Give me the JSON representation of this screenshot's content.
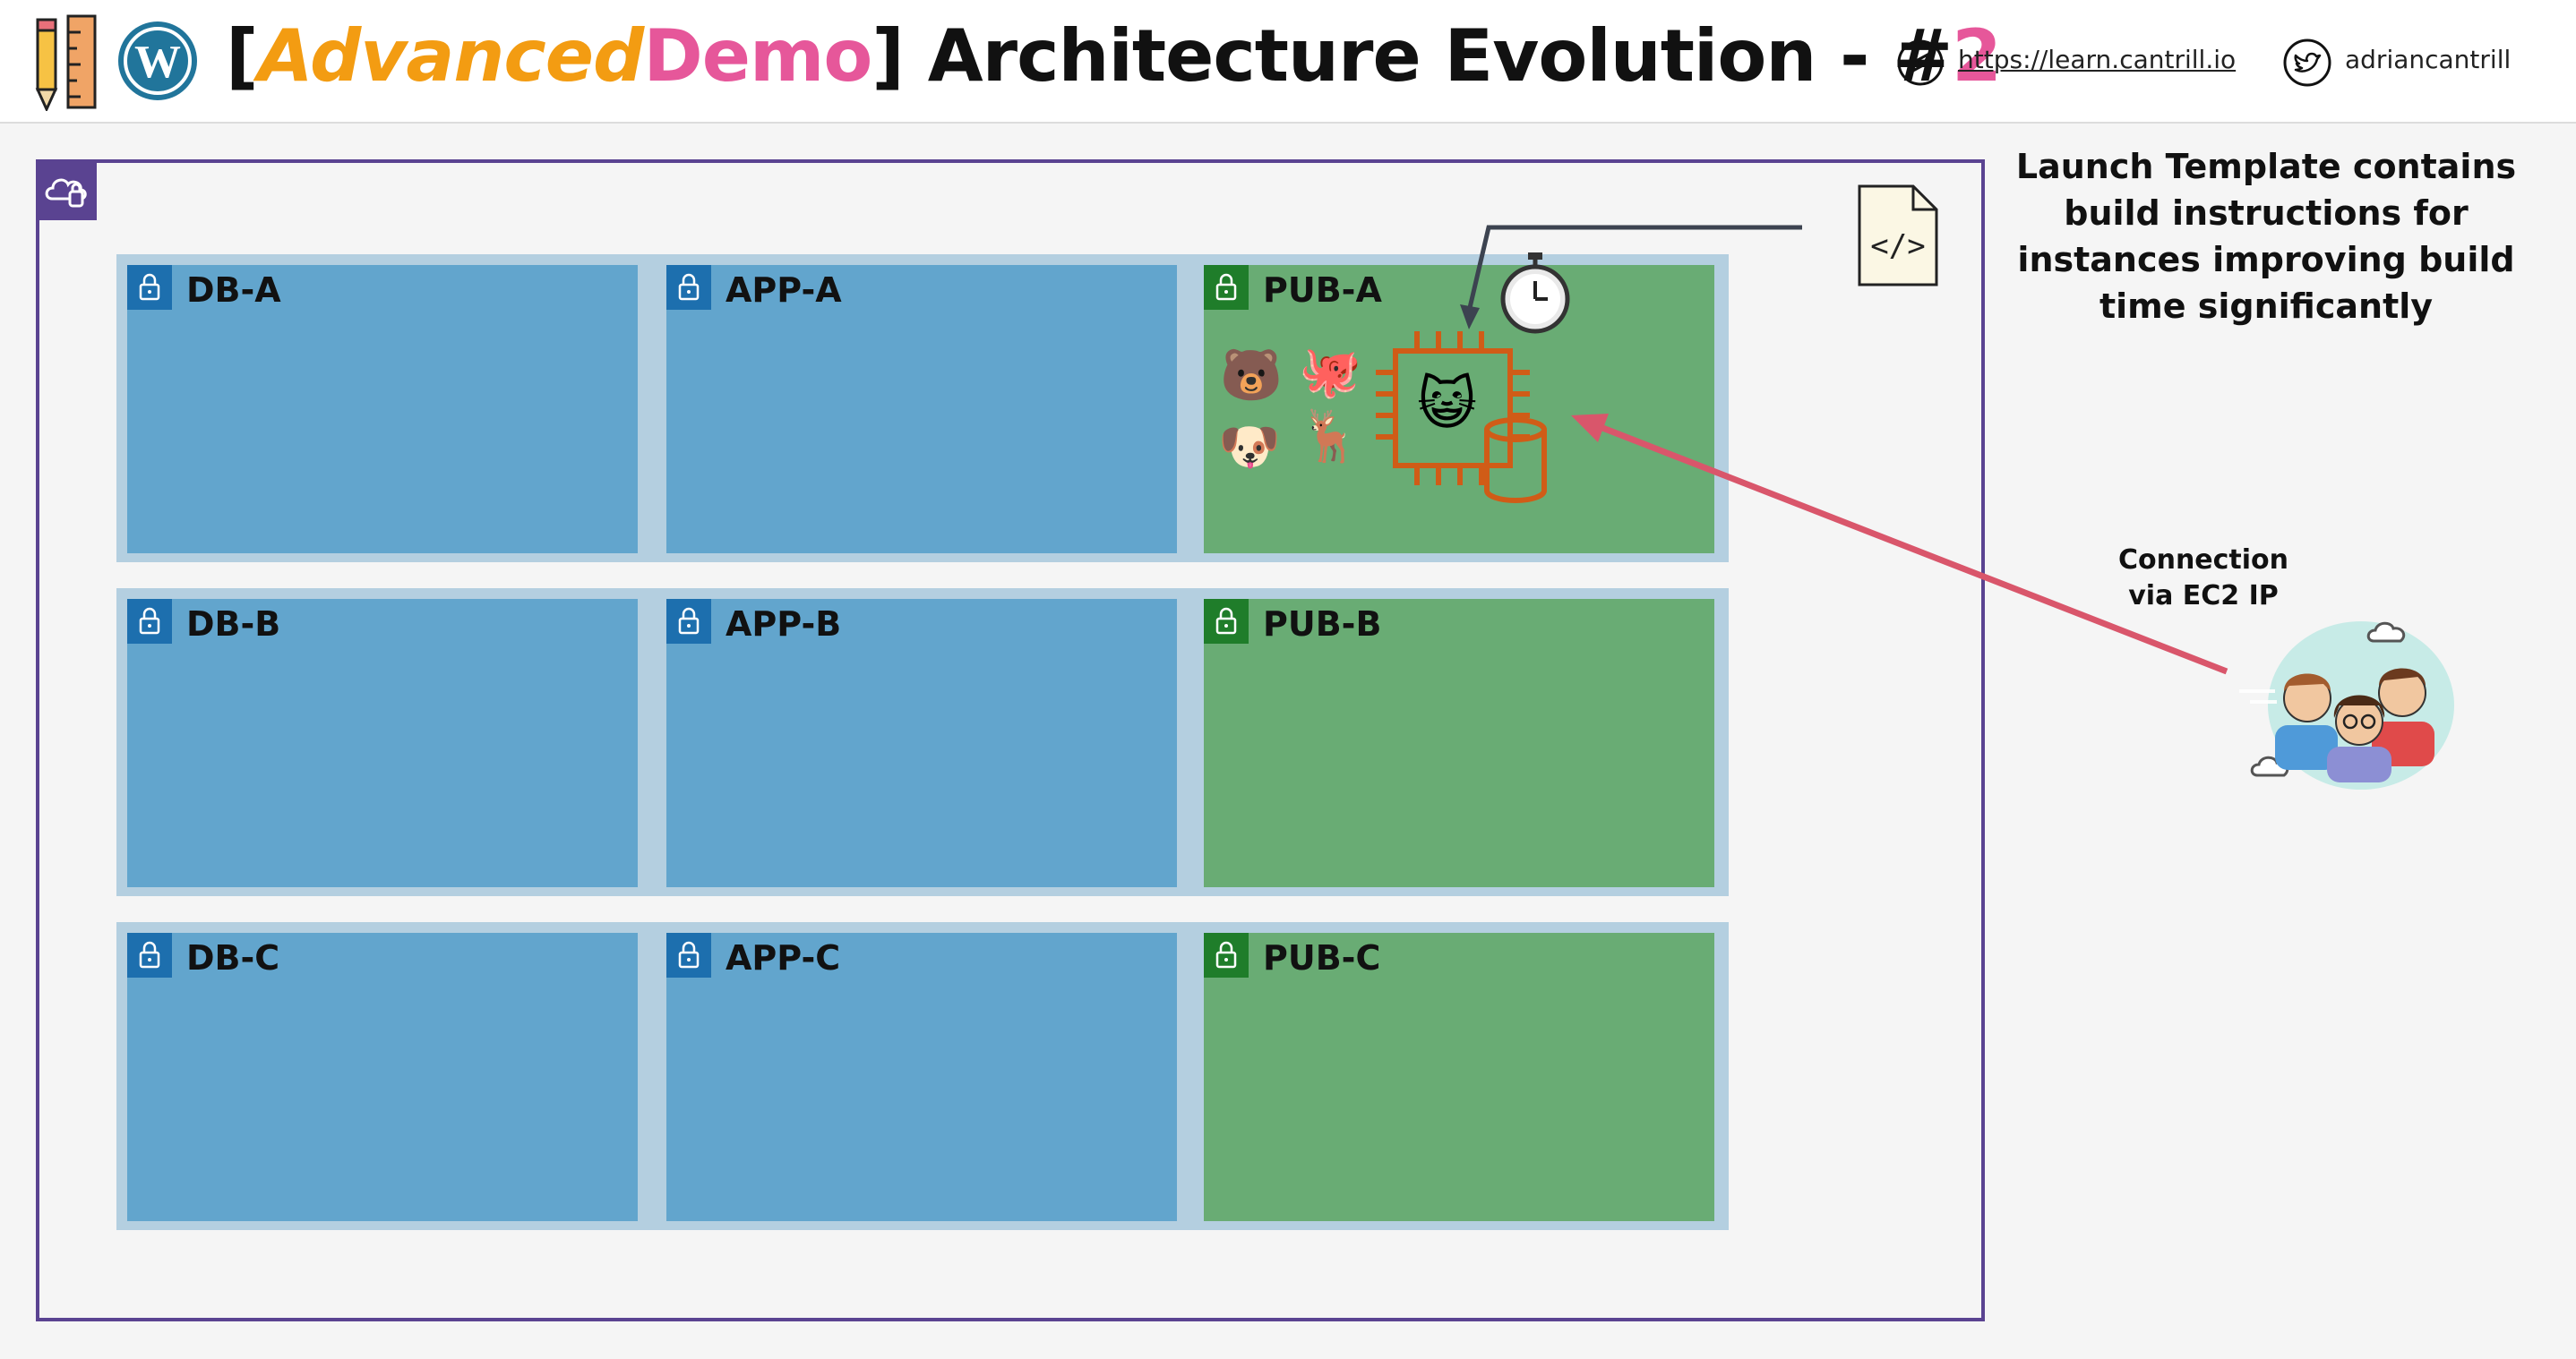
{
  "header": {
    "title_open": "[",
    "title_advanced": "Advanced",
    "title_demo": "Demo",
    "title_close": "] Architecture Evolution - #",
    "title_number": "2",
    "site_link": "https://learn.cantrill.io",
    "twitter_handle": "adriancantrill",
    "icons": [
      "pencil-ruler-icon",
      "wordpress-icon",
      "compass-icon",
      "twitter-icon"
    ]
  },
  "vpc": {
    "icon": "vpc-cloud-icon"
  },
  "subnets": [
    {
      "label": "DB-A",
      "kind": "private"
    },
    {
      "label": "APP-A",
      "kind": "private"
    },
    {
      "label": "PUB-A",
      "kind": "public"
    },
    {
      "label": "DB-B",
      "kind": "private"
    },
    {
      "label": "APP-B",
      "kind": "private"
    },
    {
      "label": "PUB-B",
      "kind": "public"
    },
    {
      "label": "DB-C",
      "kind": "private"
    },
    {
      "label": "APP-C",
      "kind": "private"
    },
    {
      "label": "PUB-C",
      "kind": "public"
    }
  ],
  "notes": {
    "launch_template_line1": "Launch Template contains",
    "launch_template_line2": "build instructions for",
    "launch_template_line3": "instances improving build",
    "launch_template_line4": "time significantly",
    "connection_line1": "Connection",
    "connection_line2": "via EC2 IP"
  },
  "colors": {
    "vpc_border": "#5a4391",
    "private_subnet": "#62a5cd",
    "public_subnet": "#69ac74",
    "ec2_orange": "#d05c17",
    "arrow_red": "#d9566b",
    "accent_orange": "#f39c12",
    "accent_pink": "#e6579a"
  }
}
